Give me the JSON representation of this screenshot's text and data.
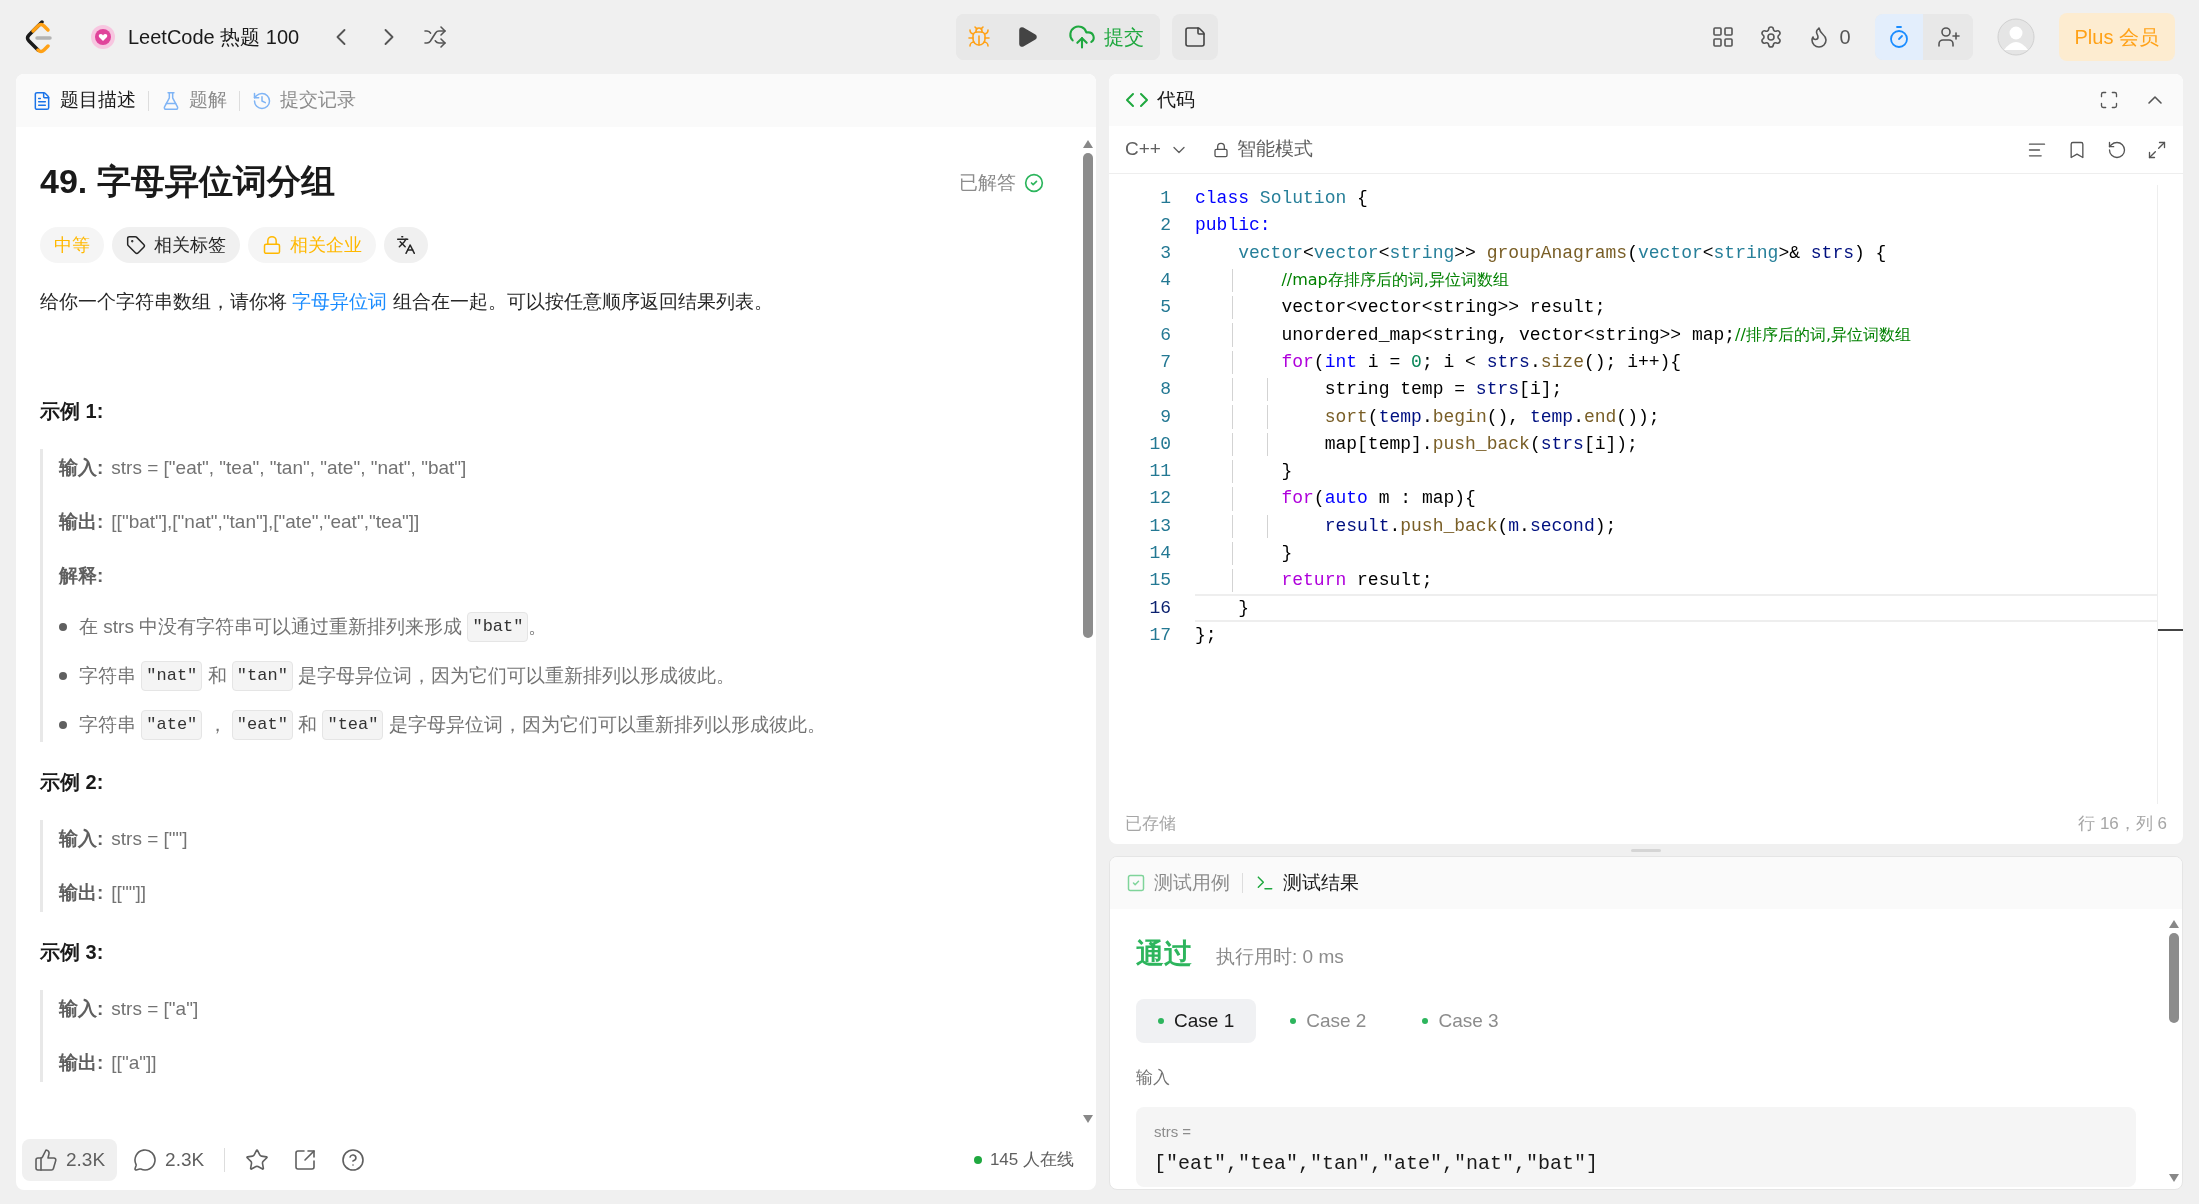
{
  "topbar": {
    "title": "LeetCode 热题 100",
    "submit": "提交",
    "streak": "0",
    "timer_active": true,
    "plus": "Plus 会员"
  },
  "problem_tabs": [
    {
      "label": "题目描述",
      "selected": true
    },
    {
      "label": "题解",
      "selected": false
    },
    {
      "label": "提交记录",
      "selected": false
    }
  ],
  "problem": {
    "title": "49. 字母异位词分组",
    "status": "已解答",
    "tags": [
      {
        "kind": "difficulty",
        "label": "中等"
      },
      {
        "kind": "topics",
        "label": "相关标签"
      },
      {
        "kind": "companies",
        "label": "相关企业"
      },
      {
        "kind": "translate"
      }
    ],
    "description": {
      "before": "给你一个字符串数组，请你将 ",
      "link": "字母异位词",
      "after": " 组合在一起。可以按任意顺序返回结果列表。"
    },
    "examples": [
      {
        "heading": "示例 1:",
        "lines": [
          {
            "label": "输入:",
            "value": "strs = [\"eat\", \"tea\", \"tan\", \"ate\", \"nat\", \"bat\"]"
          },
          {
            "label": "输出:",
            "value": "[[\"bat\"],[\"nat\",\"tan\"],[\"ate\",\"eat\",\"tea\"]]"
          }
        ],
        "explanation": {
          "label": "解释:",
          "bullets": [
            [
              {
                "kind": "text",
                "text": "在 strs 中没有字符串可以通过重新排列来形成 "
              },
              {
                "kind": "code",
                "text": "\"bat\""
              },
              {
                "kind": "text",
                "text": "。"
              }
            ],
            [
              {
                "kind": "text",
                "text": "字符串 "
              },
              {
                "kind": "code",
                "text": "\"nat\""
              },
              {
                "kind": "text",
                "text": " 和 "
              },
              {
                "kind": "code",
                "text": "\"tan\""
              },
              {
                "kind": "text",
                "text": " 是字母异位词，因为它们可以重新排列以形成彼此。"
              }
            ],
            [
              {
                "kind": "text",
                "text": "字符串 "
              },
              {
                "kind": "code",
                "text": "\"ate\""
              },
              {
                "kind": "text",
                "text": " ， "
              },
              {
                "kind": "code",
                "text": "\"eat\""
              },
              {
                "kind": "text",
                "text": " 和 "
              },
              {
                "kind": "code",
                "text": "\"tea\""
              },
              {
                "kind": "text",
                "text": " 是字母异位词，因为它们可以重新排列以形成彼此。"
              }
            ]
          ]
        }
      },
      {
        "heading": "示例 2:",
        "lines": [
          {
            "label": "输入:",
            "value": "strs = [\"\"]"
          },
          {
            "label": "输出:",
            "value": "[[\"\"]]"
          }
        ]
      },
      {
        "heading": "示例 3:",
        "lines": [
          {
            "label": "输入:",
            "value": "strs = [\"a\"]"
          },
          {
            "label": "输出:",
            "value": "[[\"a\"]]"
          }
        ]
      }
    ]
  },
  "footer": {
    "likes": "2.3K",
    "comments": "2.3K",
    "online": "145 人在线"
  },
  "editor": {
    "tab": "代码",
    "language": "C++",
    "mode": "智能模式",
    "saved": "已存储",
    "cursor": "行 16，列 6",
    "lines": [
      {
        "number": "1",
        "current": false,
        "tokens": [
          {
            "kind": "keyword",
            "text": "class"
          },
          {
            "kind": "type",
            "text": " Solution"
          },
          {
            "kind": "plain",
            "text": " {"
          }
        ]
      },
      {
        "number": "2",
        "current": false,
        "tokens": [
          {
            "kind": "keyword",
            "text": "public:"
          }
        ]
      },
      {
        "number": "3",
        "current": false,
        "tokens": [
          {
            "kind": "type",
            "text": "    vector"
          },
          {
            "kind": "plain",
            "text": "<"
          },
          {
            "kind": "type",
            "text": "vector"
          },
          {
            "kind": "plain",
            "text": "<"
          },
          {
            "kind": "type",
            "text": "string"
          },
          {
            "kind": "plain",
            "text": ">> "
          },
          {
            "kind": "function",
            "text": "groupAnagrams"
          },
          {
            "kind": "plain",
            "text": "("
          },
          {
            "kind": "type",
            "text": "vector"
          },
          {
            "kind": "plain",
            "text": "<"
          },
          {
            "kind": "type",
            "text": "string"
          },
          {
            "kind": "plain",
            "text": ">& "
          },
          {
            "kind": "variable",
            "text": "strs"
          },
          {
            "kind": "plain",
            "text": ") {"
          }
        ]
      },
      {
        "number": "4",
        "current": false,
        "tokens": [
          {
            "kind": "comment",
            "text": "        //map存排序后的词,异位词数组"
          }
        ]
      },
      {
        "number": "5",
        "current": false,
        "tokens": [
          {
            "kind": "plain",
            "text": "        vector<vector<string>> result;"
          }
        ]
      },
      {
        "number": "6",
        "current": false,
        "tokens": [
          {
            "kind": "plain",
            "text": "        unordered_map<string, vector<string>> map;"
          },
          {
            "kind": "comment",
            "text": "//排序后的词,异位词数组"
          }
        ]
      },
      {
        "number": "7",
        "current": false,
        "tokens": [
          {
            "kind": "control",
            "text": "        for"
          },
          {
            "kind": "plain",
            "text": "("
          },
          {
            "kind": "keyword",
            "text": "int"
          },
          {
            "kind": "plain",
            "text": " i = "
          },
          {
            "kind": "number",
            "text": "0"
          },
          {
            "kind": "plain",
            "text": "; i < "
          },
          {
            "kind": "variable",
            "text": "strs"
          },
          {
            "kind": "plain",
            "text": "."
          },
          {
            "kind": "function",
            "text": "size"
          },
          {
            "kind": "plain",
            "text": "(); i++){"
          }
        ]
      },
      {
        "number": "8",
        "current": false,
        "tokens": [
          {
            "kind": "plain",
            "text": "            string temp = "
          },
          {
            "kind": "variable",
            "text": "strs"
          },
          {
            "kind": "plain",
            "text": "[i];"
          }
        ]
      },
      {
        "number": "9",
        "current": false,
        "tokens": [
          {
            "kind": "function",
            "text": "            sort"
          },
          {
            "kind": "plain",
            "text": "("
          },
          {
            "kind": "variable",
            "text": "temp"
          },
          {
            "kind": "plain",
            "text": "."
          },
          {
            "kind": "function",
            "text": "begin"
          },
          {
            "kind": "plain",
            "text": "(), "
          },
          {
            "kind": "variable",
            "text": "temp"
          },
          {
            "kind": "plain",
            "text": "."
          },
          {
            "kind": "function",
            "text": "end"
          },
          {
            "kind": "plain",
            "text": "());"
          }
        ]
      },
      {
        "number": "10",
        "current": false,
        "tokens": [
          {
            "kind": "plain",
            "text": "            map[temp]."
          },
          {
            "kind": "function",
            "text": "push_back"
          },
          {
            "kind": "plain",
            "text": "("
          },
          {
            "kind": "variable",
            "text": "strs"
          },
          {
            "kind": "plain",
            "text": "[i]);"
          }
        ]
      },
      {
        "number": "11",
        "current": false,
        "tokens": [
          {
            "kind": "plain",
            "text": "        }"
          }
        ]
      },
      {
        "number": "12",
        "current": false,
        "tokens": [
          {
            "kind": "control",
            "text": "        for"
          },
          {
            "kind": "plain",
            "text": "("
          },
          {
            "kind": "keyword",
            "text": "auto"
          },
          {
            "kind": "plain",
            "text": " m : map){"
          }
        ]
      },
      {
        "number": "13",
        "current": false,
        "tokens": [
          {
            "kind": "variable",
            "text": "            result"
          },
          {
            "kind": "plain",
            "text": "."
          },
          {
            "kind": "function",
            "text": "push_back"
          },
          {
            "kind": "plain",
            "text": "("
          },
          {
            "kind": "variable",
            "text": "m"
          },
          {
            "kind": "plain",
            "text": "."
          },
          {
            "kind": "variable",
            "text": "second"
          },
          {
            "kind": "plain",
            "text": ");"
          }
        ]
      },
      {
        "number": "14",
        "current": false,
        "tokens": [
          {
            "kind": "plain",
            "text": "        }"
          }
        ]
      },
      {
        "number": "15",
        "current": false,
        "tokens": [
          {
            "kind": "control",
            "text": "        return"
          },
          {
            "kind": "plain",
            "text": " result;"
          }
        ]
      },
      {
        "number": "16",
        "current": true,
        "tokens": [
          {
            "kind": "plain",
            "text": "    }"
          }
        ]
      },
      {
        "number": "17",
        "current": false,
        "tokens": [
          {
            "kind": "plain",
            "text": "};"
          }
        ]
      }
    ]
  },
  "tests": {
    "tabs": [
      {
        "label": "测试用例",
        "selected": false
      },
      {
        "label": "测试结果",
        "selected": true
      }
    ],
    "verdict": "通过",
    "runtime": "执行用时: 0 ms",
    "cases": [
      {
        "label": "Case 1",
        "selected": true
      },
      {
        "label": "Case 2",
        "selected": false
      },
      {
        "label": "Case 3",
        "selected": false
      }
    ],
    "input_label": "输入",
    "param": "strs =",
    "value": "[\"eat\",\"tea\",\"tan\",\"ate\",\"nat\",\"bat\"]"
  }
}
